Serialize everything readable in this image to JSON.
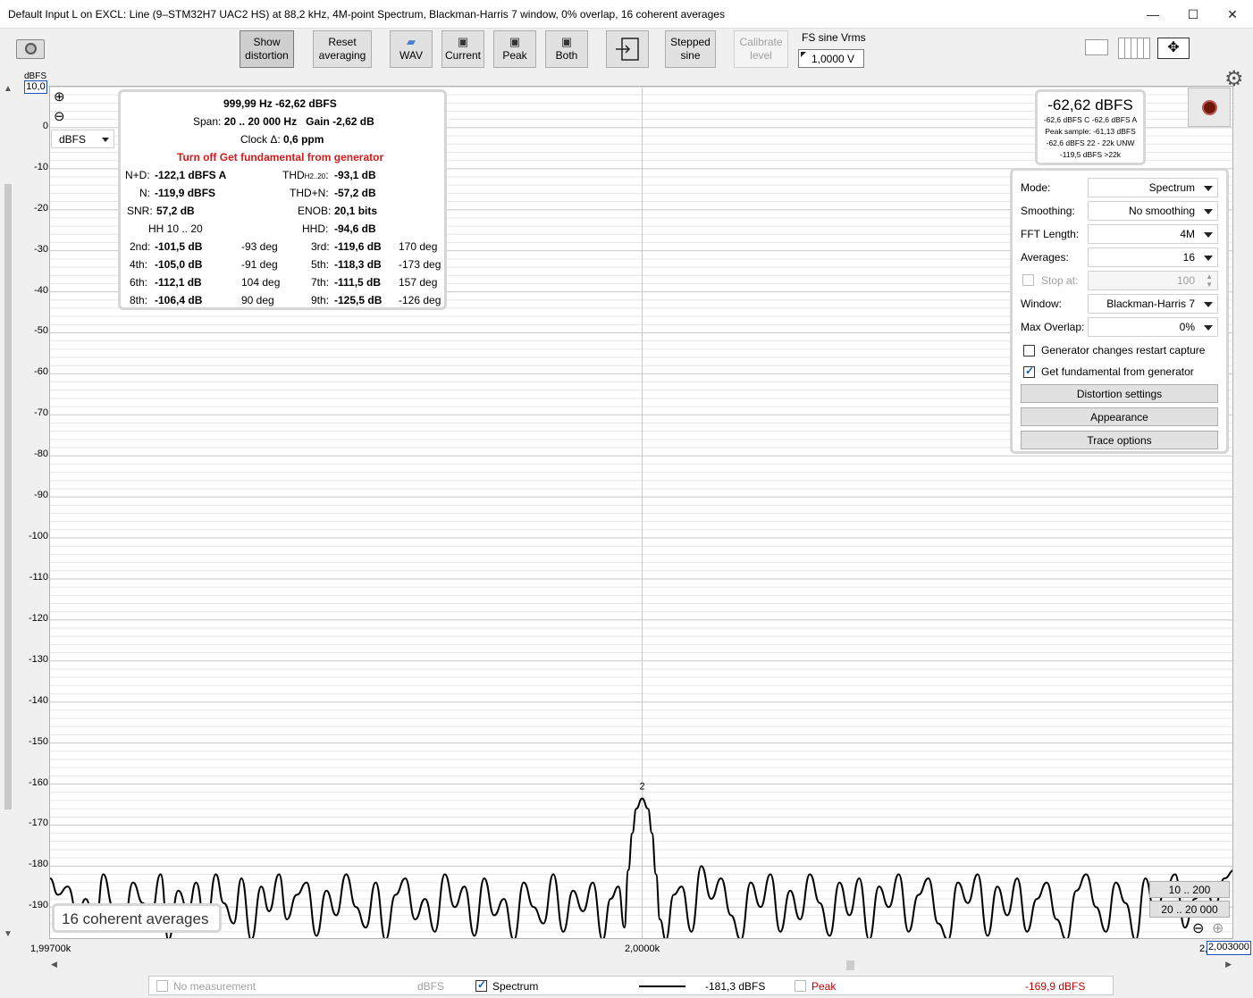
{
  "window": {
    "title": "Default Input L on EXCL: Line (9–STM32H7 UAC2 HS) at 88,2 kHz, 4M-point Spectrum, Blackman-Harris 7 window, 0% overlap, 16 coherent averages",
    "minimize": "—",
    "maximize": "☐",
    "close": "✕"
  },
  "toolbar": {
    "show_distortion": "Show distortion",
    "reset_averaging": "Reset averaging",
    "wav": "WAV",
    "current": "Current",
    "peak": "Peak",
    "both": "Both",
    "stepped_sine": "Stepped sine",
    "calibrate_level": "Calibrate level",
    "fs_label": "FS sine Vrms",
    "fs_value": "1,0000 V"
  },
  "axes": {
    "y_unit": "dBFS",
    "y_max_box": "10,0",
    "unit_select": "dBFS",
    "x_left": "1,99700k",
    "x_mid": "2,0000k",
    "x_right_prefix": "2,",
    "x_right_box": "2,003000"
  },
  "chart_data": {
    "type": "line",
    "xlabel": "",
    "ylabel": "dBFS",
    "xlim": [
      1997.0,
      2003.0
    ],
    "ylim": [
      -198,
      10
    ],
    "y_ticks": [
      "0",
      "-10",
      "-20",
      "-30",
      "-40",
      "-50",
      "-60",
      "-70",
      "-80",
      "-90",
      "-100",
      "-110",
      "-120",
      "-130",
      "-140",
      "-150",
      "-160",
      "-170",
      "-180",
      "-190"
    ],
    "y_tick_values": [
      0,
      -10,
      -20,
      -30,
      -40,
      -50,
      -60,
      -70,
      -80,
      -90,
      -100,
      -110,
      -120,
      -130,
      -140,
      -150,
      -160,
      -170,
      -180,
      -190
    ],
    "marker_label": "2",
    "series": [
      {
        "name": "Spectrum",
        "x": [
          1997.0,
          1997.04,
          1997.09,
          1997.14,
          1997.18,
          1997.23,
          1997.27,
          1997.32,
          1997.37,
          1997.42,
          1997.47,
          1997.51,
          1997.56,
          1997.6,
          1997.65,
          1997.7,
          1997.74,
          1997.79,
          1997.84,
          1997.88,
          1997.93,
          1997.97,
          1998.02,
          1998.07,
          1998.11,
          1998.16,
          1998.2,
          1998.25,
          1998.3,
          1998.35,
          1998.4,
          1998.45,
          1998.5,
          1998.55,
          1998.6,
          1998.65,
          1998.7,
          1998.75,
          1998.8,
          1998.85,
          1998.9,
          1998.95,
          1999.0,
          1999.05,
          1999.1,
          1999.15,
          1999.2,
          1999.25,
          1999.3,
          1999.35,
          1999.4,
          1999.45,
          1999.5,
          1999.55,
          1999.6,
          1999.65,
          1999.7,
          1999.75,
          1999.8,
          1999.84,
          1999.88,
          1999.91,
          1999.93,
          1999.95,
          1999.97,
          2000.0,
          2000.03,
          2000.05,
          2000.07,
          2000.09,
          2000.12,
          2000.16,
          2000.2,
          2000.25,
          2000.3,
          2000.35,
          2000.4,
          2000.45,
          2000.5,
          2000.55,
          2000.6,
          2000.65,
          2000.7,
          2000.75,
          2000.8,
          2000.85,
          2000.9,
          2000.95,
          2001.0,
          2001.05,
          2001.1,
          2001.15,
          2001.2,
          2001.25,
          2001.3,
          2001.35,
          2001.4,
          2001.45,
          2001.5,
          2001.55,
          2001.6,
          2001.65,
          2001.7,
          2001.75,
          2001.8,
          2001.85,
          2001.9,
          2001.95,
          2002.0,
          2002.05,
          2002.1,
          2002.15,
          2002.2,
          2002.25,
          2002.3,
          2002.35,
          2002.4,
          2002.45,
          2002.5,
          2002.55,
          2002.6,
          2002.65,
          2002.7,
          2002.75,
          2002.8,
          2002.85,
          2002.9,
          2002.95,
          2003.0
        ],
        "values": [
          -183,
          -187,
          -185,
          -192,
          -188,
          -195,
          -182,
          -190,
          -196,
          -184,
          -189,
          -193,
          -182,
          -198,
          -186,
          -191,
          -184,
          -196,
          -182,
          -189,
          -194,
          -183,
          -198,
          -185,
          -191,
          -182,
          -193,
          -187,
          -184,
          -197,
          -186,
          -192,
          -182,
          -190,
          -195,
          -184,
          -198,
          -187,
          -183,
          -193,
          -188,
          -196,
          -182,
          -190,
          -185,
          -197,
          -183,
          -192,
          -188,
          -198,
          -184,
          -190,
          -194,
          -182,
          -196,
          -186,
          -191,
          -184,
          -198,
          -188,
          -185,
          -195,
          -181,
          -172,
          -166,
          -163.5,
          -166,
          -172,
          -182,
          -193,
          -198,
          -187,
          -185,
          -196,
          -180,
          -188,
          -183,
          -192,
          -198,
          -184,
          -190,
          -182,
          -196,
          -186,
          -193,
          -182,
          -189,
          -197,
          -184,
          -192,
          -183,
          -198,
          -185,
          -190,
          -182,
          -196,
          -187,
          -183,
          -194,
          -198,
          -184,
          -189,
          -182,
          -197,
          -185,
          -192,
          -183,
          -196,
          -188,
          -184,
          -193,
          -198,
          -186,
          -182,
          -190,
          -196,
          -184,
          -189,
          -198,
          -183,
          -192,
          -186,
          -182,
          -195,
          -188,
          -184,
          -190,
          -183,
          -181
        ]
      }
    ]
  },
  "distortion": {
    "freq_level": "999,99 Hz  -62,62 dBFS",
    "span_label": "Span:",
    "span_value": "20 .. 20 000 Hz",
    "gain_label": "Gain",
    "gain_value": "-2,62 dB",
    "clock_label": "Clock Δ:",
    "clock_value": "0,6 ppm",
    "warning": "Turn off Get fundamental from generator",
    "nd_label": "N+D:",
    "nd_value": "-122,1 dBFS A",
    "thd_label": "THD",
    "thd_sub": "H2..20",
    "thd_value": "-93,1 dB",
    "n_label": "N:",
    "n_value": "-119,9 dBFS",
    "thdn_label": "THD+N:",
    "thdn_value": "-57,2 dB",
    "snr_label": "SNR:",
    "snr_value": "57,2 dB",
    "enob_label": "ENOB:",
    "enob_value": "20,1 bits",
    "hh_label": "HH 10 .. 20",
    "hhd_label": "HHD:",
    "hhd_value": "-94,6 dB",
    "harmonics": [
      {
        "l1": "2nd:",
        "v1": "-101,5 dB",
        "p1": "-93 deg",
        "l2": "3rd:",
        "v2": "-119,6 dB",
        "p2": "170 deg"
      },
      {
        "l1": "4th:",
        "v1": "-105,0 dB",
        "p1": "-91 deg",
        "l2": "5th:",
        "v2": "-118,3 dB",
        "p2": "-173 deg"
      },
      {
        "l1": "6th:",
        "v1": "-112,1 dB",
        "p1": "104 deg",
        "l2": "7th:",
        "v2": "-111,5 dB",
        "p2": "157 deg"
      },
      {
        "l1": "8th:",
        "v1": "-106,4 dB",
        "p1": "90 deg",
        "l2": "9th:",
        "v2": "-125,5 dB",
        "p2": "-126 deg"
      }
    ]
  },
  "level": {
    "main": "-62,62 dBFS",
    "line1": "-62,6 dBFS C  -62,6 dBFS A",
    "line2": "Peak sample: -61,13 dBFS",
    "line3": "-62,6 dBFS 22 - 22k UNW",
    "line4": "-119,5 dBFS >22k"
  },
  "settings": {
    "mode_label": "Mode:",
    "mode_value": "Spectrum",
    "smoothing_label": "Smoothing:",
    "smoothing_value": "No smoothing",
    "fft_label": "FFT Length:",
    "fft_value": "4M",
    "averages_label": "Averages:",
    "averages_value": "16",
    "stop_label": "Stop at:",
    "stop_value": "100",
    "window_label": "Window:",
    "window_value": "Blackman-Harris 7",
    "overlap_label": "Max Overlap:",
    "overlap_value": "0%",
    "gen_restart": "Generator changes restart capture",
    "get_fundamental": "Get fundamental from generator",
    "distortion_settings": "Distortion settings",
    "appearance": "Appearance",
    "trace_options": "Trace options"
  },
  "range_buttons": {
    "r1": "10 .. 200",
    "r2": "20 .. 20 000"
  },
  "averages_banner": "16 coherent averages",
  "legend": {
    "no_measurement": "No measurement",
    "no_measurement_unit": "dBFS",
    "spectrum": "Spectrum",
    "spectrum_value": "-181,3 dBFS",
    "peak": "Peak",
    "peak_value": "-169,9 dBFS",
    "peak_color": "#c00000"
  }
}
